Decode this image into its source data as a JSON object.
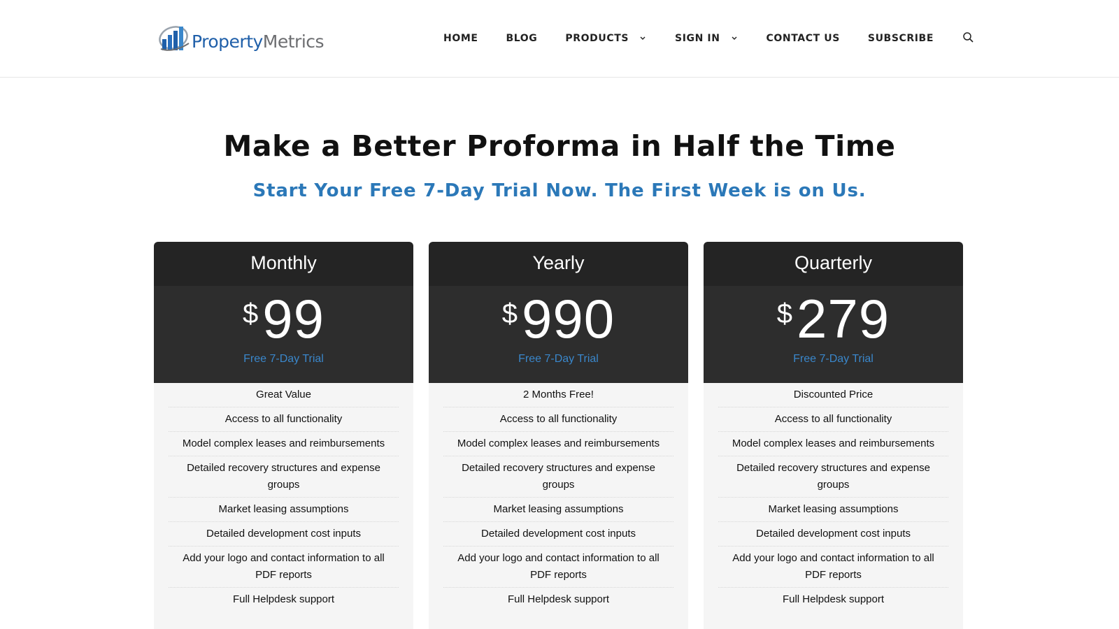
{
  "header": {
    "logo": {
      "text_part1": "Property",
      "text_part2": "Metrics"
    },
    "nav": {
      "home": "HOME",
      "blog": "BLOG",
      "products": "PRODUCTS",
      "sign_in": "SIGN IN",
      "contact": "CONTACT US",
      "subscribe": "SUBSCRIBE"
    }
  },
  "hero": {
    "title": "Make a Better Proforma in Half the Time",
    "subtitle": "Start Your Free 7-Day Trial Now. The First Week is on Us."
  },
  "plans": [
    {
      "name": "Monthly",
      "currency": "$",
      "price": "99",
      "trial": "Free 7-Day Trial",
      "features": [
        "Great Value",
        "Access to all functionality",
        "Model complex leases and reimbursements",
        "Detailed recovery structures and expense groups",
        "Market leasing assumptions",
        "Detailed development cost inputs",
        "Add your logo and contact information to all PDF reports",
        "Full Helpdesk support"
      ]
    },
    {
      "name": "Yearly",
      "currency": "$",
      "price": "990",
      "trial": "Free 7-Day Trial",
      "features": [
        "2 Months Free!",
        "Access to all functionality",
        "Model complex leases and reimbursements",
        "Detailed recovery structures and expense groups",
        "Market leasing assumptions",
        "Detailed development cost inputs",
        "Add your logo and contact information to all PDF reports",
        "Full Helpdesk support"
      ]
    },
    {
      "name": "Quarterly",
      "currency": "$",
      "price": "279",
      "trial": "Free 7-Day Trial",
      "features": [
        "Discounted Price",
        "Access to all functionality",
        "Model complex leases and reimbursements",
        "Detailed recovery structures and expense groups",
        "Market leasing assumptions",
        "Detailed development cost inputs",
        "Add your logo and contact information to all PDF reports",
        "Full Helpdesk support"
      ]
    }
  ],
  "icons": {
    "logo": "bar-chart-logo-icon",
    "caret": "chevron-down-icon",
    "search": "search-icon"
  },
  "colors": {
    "brand_blue": "#1f5fa9",
    "accent_blue": "#2b78b8",
    "trial_blue": "#3a87cb",
    "card_dark": "#242424",
    "card_price_bg": "#2d2d2d",
    "feature_bg": "#f5f5f5"
  }
}
